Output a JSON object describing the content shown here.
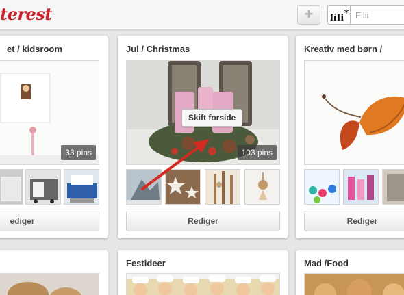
{
  "app": {
    "logo_text": "terest",
    "add_symbol": "+",
    "search_logo": "fili",
    "search_logo_mark": "*",
    "search_placeholder": "Filii"
  },
  "colors": {
    "brand_red": "#c8232c",
    "page_bg": "#e8e6e6",
    "arrow_red": "#d42a22"
  },
  "boards": [
    {
      "title": "et / kidsroom",
      "pin_count": "33 pins",
      "edit_label": "ediger"
    },
    {
      "title": "Jul / Christmas",
      "pin_count": "103 pins",
      "edit_label": "Rediger",
      "tooltip": "Skift forside"
    },
    {
      "title": "Kreativ med børn /",
      "edit_label": "Rediger"
    },
    {
      "title": "",
      "edit_label": ""
    },
    {
      "title": "Festideer"
    },
    {
      "title": "Mad /Food"
    }
  ]
}
